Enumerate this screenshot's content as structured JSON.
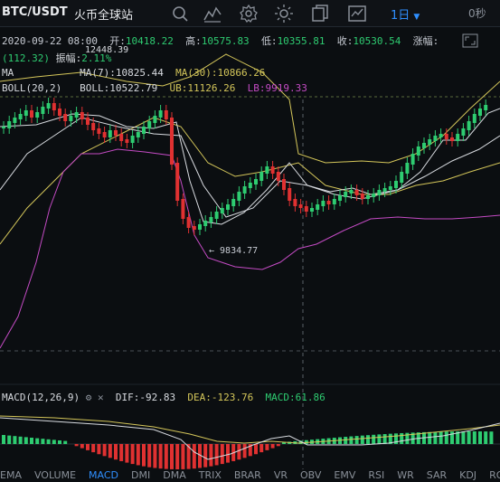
{
  "toolbar": {
    "pair": "BTC/USDT",
    "exchange": "火币全球站",
    "interval": "1日",
    "countdown": "0秒",
    "icons": [
      "search-icon",
      "indicator-icon",
      "settings-icon",
      "theme-icon",
      "copy-icon",
      "chart-icon"
    ]
  },
  "info": {
    "date": "2020-09-22 08:00",
    "open_label": "开:",
    "open": "10418.22",
    "high_label": "高:",
    "high": "10575.83",
    "low_label": "低:",
    "low": "10355.81",
    "close_label": "收:",
    "close": "10530.54",
    "change_label": "涨幅:",
    "change_prev": "(112.32)",
    "amplitude_label": "振幅:",
    "amplitude": "2.11%",
    "ma_label": "MA",
    "ma7_label": "MA(7):",
    "ma7": "10825.44",
    "ma30_label": "MA(30):",
    "ma30": "10866.26",
    "boll_label": "BOLL(20,2)",
    "boll_mid_label": "BOLL:",
    "boll_mid": "10522.79",
    "boll_ub_label": "UB:",
    "boll_ub": "11126.26",
    "boll_lb_label": "LB:",
    "boll_lb": "9919.33",
    "peak_label": "12448.39",
    "low_marker": "← 9834.77"
  },
  "macd": {
    "label": "MACD(12,26,9)",
    "dif_label": "DIF:",
    "dif": "-92.83",
    "dea_label": "DEA:",
    "dea": "-123.76",
    "macd_label": "MACD:",
    "macd": "61.86"
  },
  "tabs": [
    "EMA",
    "VOLUME",
    "MACD",
    "DMI",
    "DMA",
    "TRIX",
    "BRAR",
    "VR",
    "OBV",
    "EMV",
    "RSI",
    "WR",
    "SAR",
    "KDJ",
    "ROC"
  ],
  "active_tab": "MACD",
  "colors": {
    "up": "#2ecc71",
    "down": "#e03131",
    "ma7": "#d8dbe0",
    "ma30": "#d4c65a",
    "boll_lb": "#c44bc4",
    "accent": "#2f8fff",
    "background": "#0b0e11"
  }
}
